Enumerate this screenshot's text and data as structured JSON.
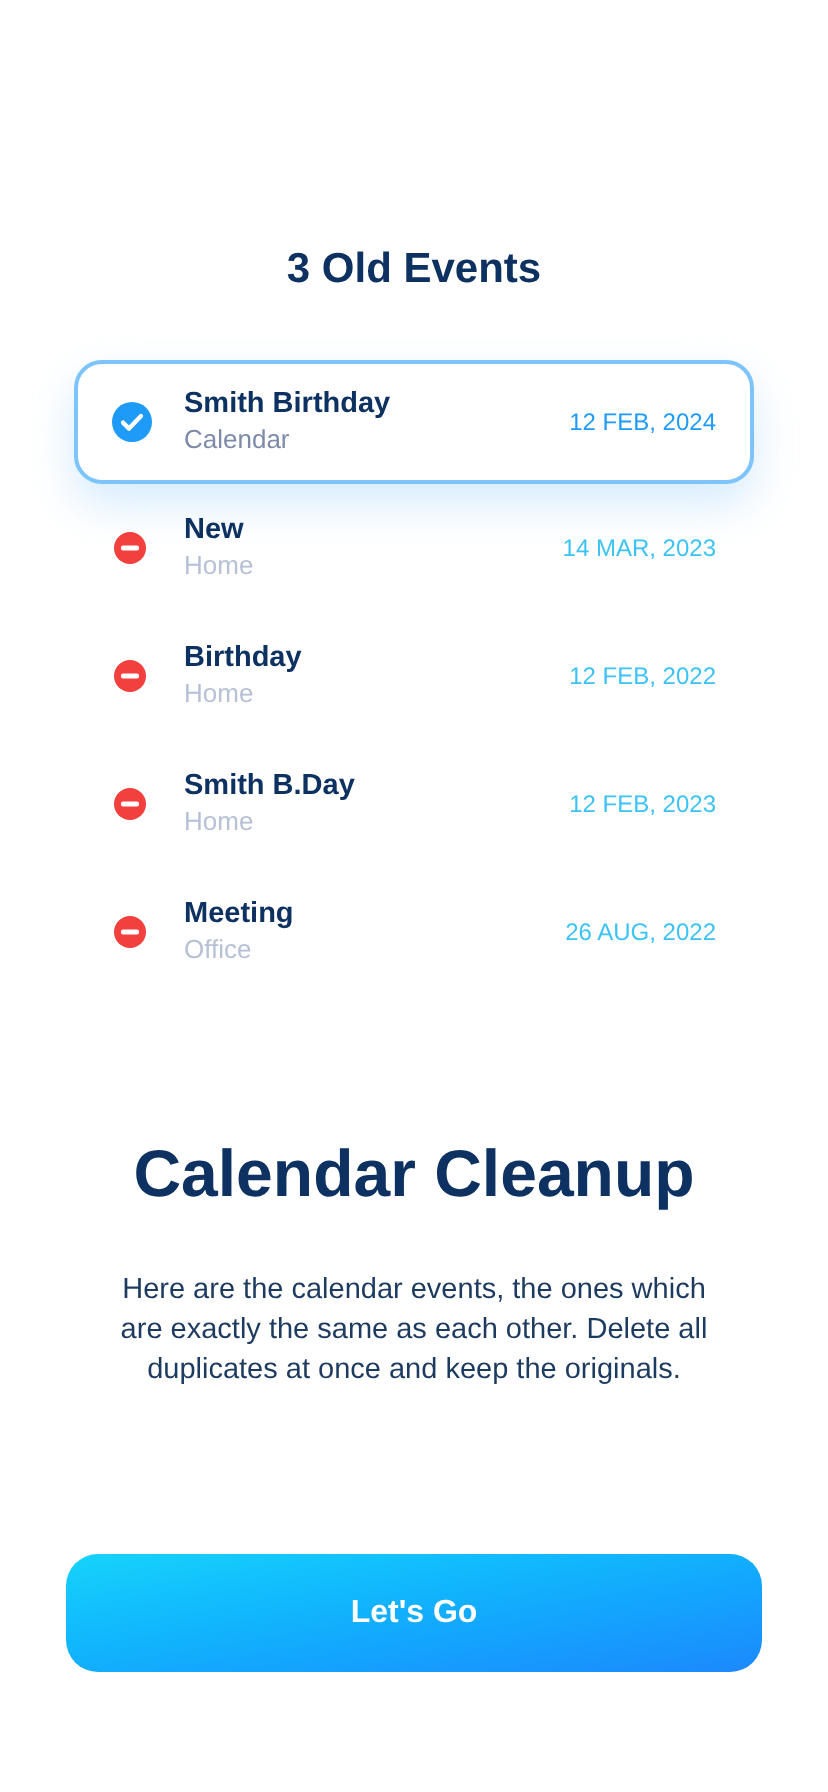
{
  "list_title": "3 Old Events",
  "events": [
    {
      "title": "Smith Birthday",
      "calendar": "Calendar",
      "date": "12 FEB, 2024",
      "selected": true
    },
    {
      "title": "New",
      "calendar": "Home",
      "date": "14 MAR, 2023",
      "selected": false
    },
    {
      "title": "Birthday",
      "calendar": "Home",
      "date": "12 FEB, 2022",
      "selected": false
    },
    {
      "title": "Smith B.Day",
      "calendar": "Home",
      "date": "12 FEB, 2023",
      "selected": false
    },
    {
      "title": "Meeting",
      "calendar": "Office",
      "date": "26 AUG, 2022",
      "selected": false
    }
  ],
  "heading": "Calendar Cleanup",
  "description": "Here are the calendar events, the ones which are exactly the same as each other. Delete all duplicates at once and keep the originals.",
  "button": "Let's Go"
}
